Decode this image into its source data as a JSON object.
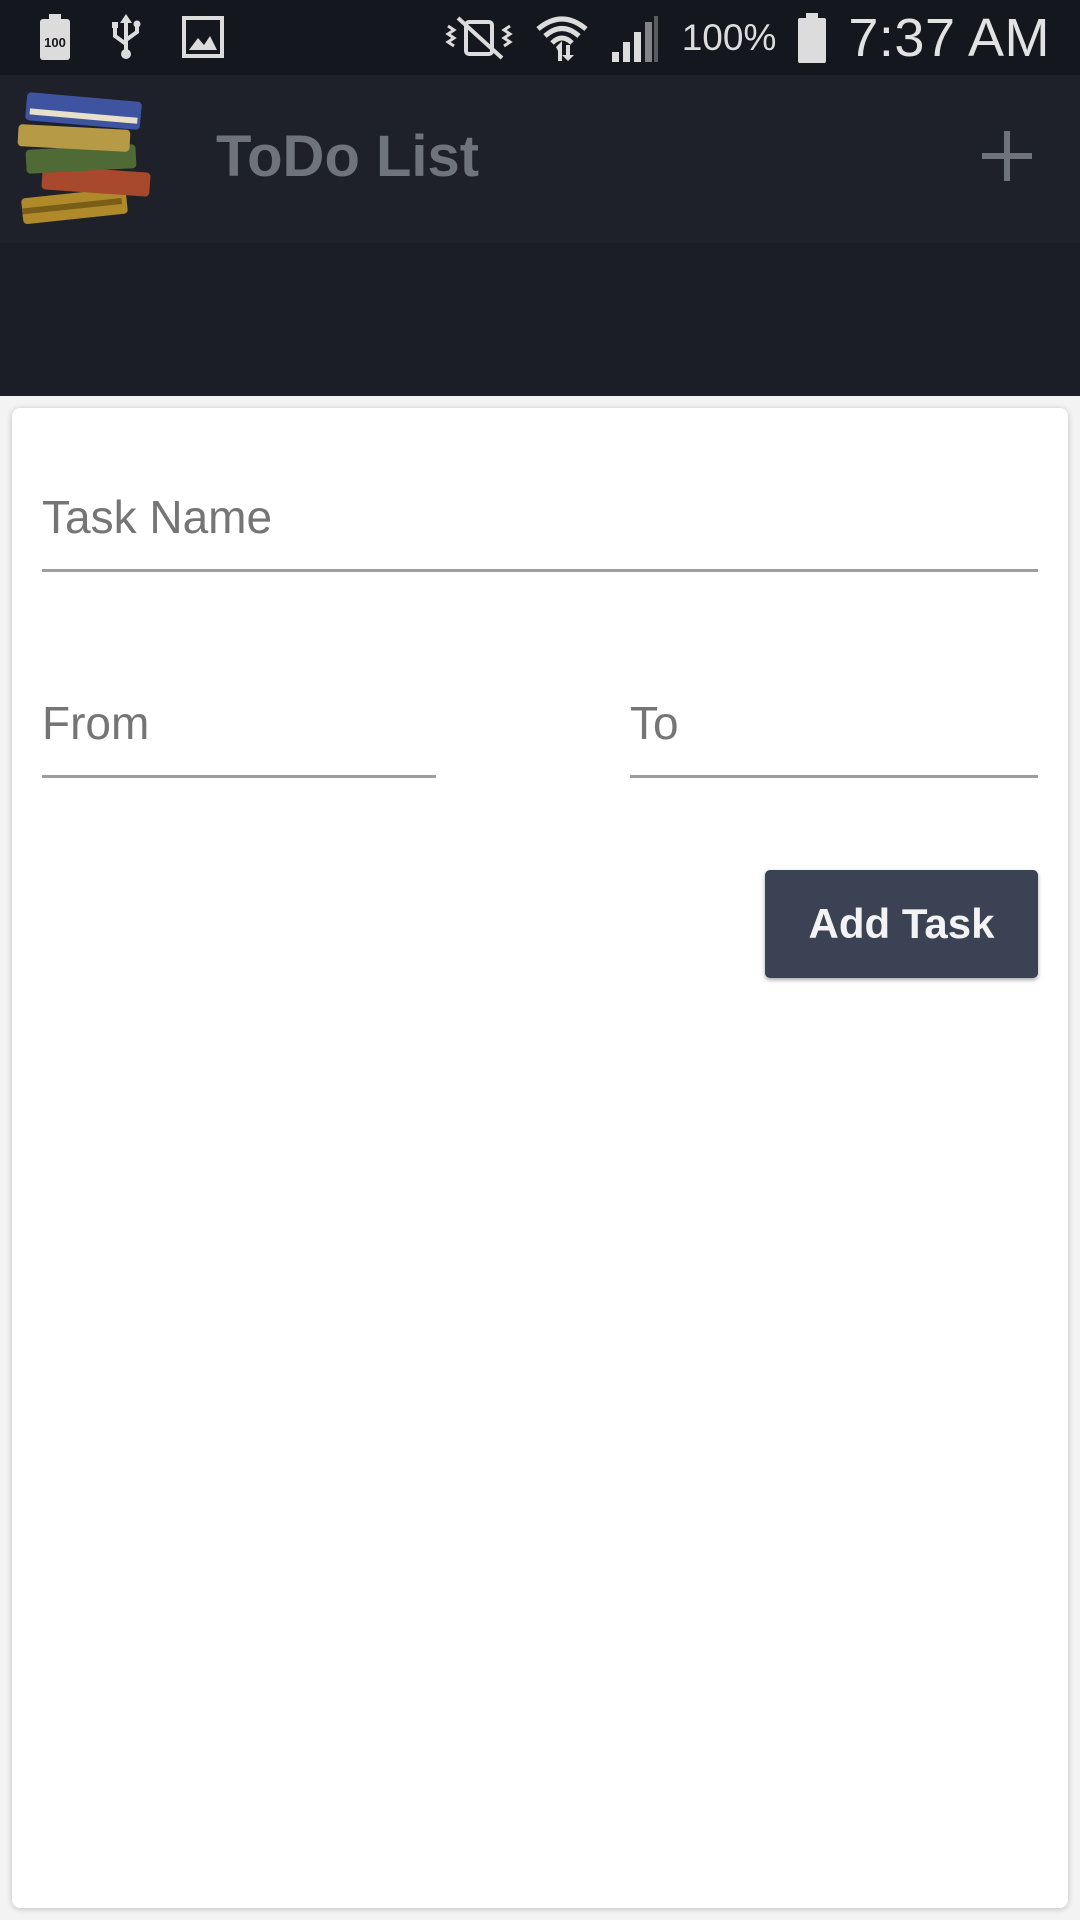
{
  "status_bar": {
    "battery_level_icon_text": "100",
    "battery_percent": "100%",
    "time": "7:37 AM",
    "icons": [
      "battery-saver-icon",
      "usb-icon",
      "image-icon",
      "vibrate-mute-icon",
      "wifi-icon",
      "cell-signal-icon",
      "battery-icon"
    ]
  },
  "app_bar": {
    "title": "ToDo List",
    "logo_icon": "books-stack-icon",
    "action_icon": "plus-icon"
  },
  "form": {
    "task_name_placeholder": "Task Name",
    "task_name_value": "",
    "from_placeholder": "From",
    "from_value": "",
    "to_placeholder": "To",
    "to_value": "",
    "add_button_label": "Add Task"
  },
  "colors": {
    "status_bar_bg": "#15171e",
    "app_bar_bg": "#1e212a",
    "button_bg": "#3b4254",
    "title_text": "#6f737b"
  }
}
